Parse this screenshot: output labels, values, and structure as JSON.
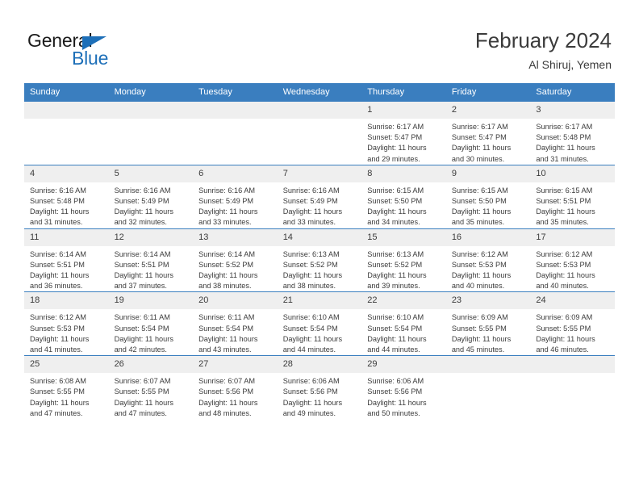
{
  "brand": {
    "name_primary": "General",
    "name_secondary": "Blue",
    "accent_color": "#1d6fb8"
  },
  "header": {
    "title": "February 2024",
    "subtitle": "Al Shiruj, Yemen"
  },
  "theme": {
    "header_row_bg": "#3a7ebf",
    "daynum_bg": "#efefef",
    "text_color": "#3b3b3b"
  },
  "calendar": {
    "weekday_headers": [
      "Sunday",
      "Monday",
      "Tuesday",
      "Wednesday",
      "Thursday",
      "Friday",
      "Saturday"
    ],
    "weeks": [
      [
        {
          "day": "",
          "sunrise": "",
          "sunset": "",
          "daylight_line1": "",
          "daylight_line2": ""
        },
        {
          "day": "",
          "sunrise": "",
          "sunset": "",
          "daylight_line1": "",
          "daylight_line2": ""
        },
        {
          "day": "",
          "sunrise": "",
          "sunset": "",
          "daylight_line1": "",
          "daylight_line2": ""
        },
        {
          "day": "",
          "sunrise": "",
          "sunset": "",
          "daylight_line1": "",
          "daylight_line2": ""
        },
        {
          "day": "1",
          "sunrise": "Sunrise: 6:17 AM",
          "sunset": "Sunset: 5:47 PM",
          "daylight_line1": "Daylight: 11 hours",
          "daylight_line2": "and 29 minutes."
        },
        {
          "day": "2",
          "sunrise": "Sunrise: 6:17 AM",
          "sunset": "Sunset: 5:47 PM",
          "daylight_line1": "Daylight: 11 hours",
          "daylight_line2": "and 30 minutes."
        },
        {
          "day": "3",
          "sunrise": "Sunrise: 6:17 AM",
          "sunset": "Sunset: 5:48 PM",
          "daylight_line1": "Daylight: 11 hours",
          "daylight_line2": "and 31 minutes."
        }
      ],
      [
        {
          "day": "4",
          "sunrise": "Sunrise: 6:16 AM",
          "sunset": "Sunset: 5:48 PM",
          "daylight_line1": "Daylight: 11 hours",
          "daylight_line2": "and 31 minutes."
        },
        {
          "day": "5",
          "sunrise": "Sunrise: 6:16 AM",
          "sunset": "Sunset: 5:49 PM",
          "daylight_line1": "Daylight: 11 hours",
          "daylight_line2": "and 32 minutes."
        },
        {
          "day": "6",
          "sunrise": "Sunrise: 6:16 AM",
          "sunset": "Sunset: 5:49 PM",
          "daylight_line1": "Daylight: 11 hours",
          "daylight_line2": "and 33 minutes."
        },
        {
          "day": "7",
          "sunrise": "Sunrise: 6:16 AM",
          "sunset": "Sunset: 5:49 PM",
          "daylight_line1": "Daylight: 11 hours",
          "daylight_line2": "and 33 minutes."
        },
        {
          "day": "8",
          "sunrise": "Sunrise: 6:15 AM",
          "sunset": "Sunset: 5:50 PM",
          "daylight_line1": "Daylight: 11 hours",
          "daylight_line2": "and 34 minutes."
        },
        {
          "day": "9",
          "sunrise": "Sunrise: 6:15 AM",
          "sunset": "Sunset: 5:50 PM",
          "daylight_line1": "Daylight: 11 hours",
          "daylight_line2": "and 35 minutes."
        },
        {
          "day": "10",
          "sunrise": "Sunrise: 6:15 AM",
          "sunset": "Sunset: 5:51 PM",
          "daylight_line1": "Daylight: 11 hours",
          "daylight_line2": "and 35 minutes."
        }
      ],
      [
        {
          "day": "11",
          "sunrise": "Sunrise: 6:14 AM",
          "sunset": "Sunset: 5:51 PM",
          "daylight_line1": "Daylight: 11 hours",
          "daylight_line2": "and 36 minutes."
        },
        {
          "day": "12",
          "sunrise": "Sunrise: 6:14 AM",
          "sunset": "Sunset: 5:51 PM",
          "daylight_line1": "Daylight: 11 hours",
          "daylight_line2": "and 37 minutes."
        },
        {
          "day": "13",
          "sunrise": "Sunrise: 6:14 AM",
          "sunset": "Sunset: 5:52 PM",
          "daylight_line1": "Daylight: 11 hours",
          "daylight_line2": "and 38 minutes."
        },
        {
          "day": "14",
          "sunrise": "Sunrise: 6:13 AM",
          "sunset": "Sunset: 5:52 PM",
          "daylight_line1": "Daylight: 11 hours",
          "daylight_line2": "and 38 minutes."
        },
        {
          "day": "15",
          "sunrise": "Sunrise: 6:13 AM",
          "sunset": "Sunset: 5:52 PM",
          "daylight_line1": "Daylight: 11 hours",
          "daylight_line2": "and 39 minutes."
        },
        {
          "day": "16",
          "sunrise": "Sunrise: 6:12 AM",
          "sunset": "Sunset: 5:53 PM",
          "daylight_line1": "Daylight: 11 hours",
          "daylight_line2": "and 40 minutes."
        },
        {
          "day": "17",
          "sunrise": "Sunrise: 6:12 AM",
          "sunset": "Sunset: 5:53 PM",
          "daylight_line1": "Daylight: 11 hours",
          "daylight_line2": "and 40 minutes."
        }
      ],
      [
        {
          "day": "18",
          "sunrise": "Sunrise: 6:12 AM",
          "sunset": "Sunset: 5:53 PM",
          "daylight_line1": "Daylight: 11 hours",
          "daylight_line2": "and 41 minutes."
        },
        {
          "day": "19",
          "sunrise": "Sunrise: 6:11 AM",
          "sunset": "Sunset: 5:54 PM",
          "daylight_line1": "Daylight: 11 hours",
          "daylight_line2": "and 42 minutes."
        },
        {
          "day": "20",
          "sunrise": "Sunrise: 6:11 AM",
          "sunset": "Sunset: 5:54 PM",
          "daylight_line1": "Daylight: 11 hours",
          "daylight_line2": "and 43 minutes."
        },
        {
          "day": "21",
          "sunrise": "Sunrise: 6:10 AM",
          "sunset": "Sunset: 5:54 PM",
          "daylight_line1": "Daylight: 11 hours",
          "daylight_line2": "and 44 minutes."
        },
        {
          "day": "22",
          "sunrise": "Sunrise: 6:10 AM",
          "sunset": "Sunset: 5:54 PM",
          "daylight_line1": "Daylight: 11 hours",
          "daylight_line2": "and 44 minutes."
        },
        {
          "day": "23",
          "sunrise": "Sunrise: 6:09 AM",
          "sunset": "Sunset: 5:55 PM",
          "daylight_line1": "Daylight: 11 hours",
          "daylight_line2": "and 45 minutes."
        },
        {
          "day": "24",
          "sunrise": "Sunrise: 6:09 AM",
          "sunset": "Sunset: 5:55 PM",
          "daylight_line1": "Daylight: 11 hours",
          "daylight_line2": "and 46 minutes."
        }
      ],
      [
        {
          "day": "25",
          "sunrise": "Sunrise: 6:08 AM",
          "sunset": "Sunset: 5:55 PM",
          "daylight_line1": "Daylight: 11 hours",
          "daylight_line2": "and 47 minutes."
        },
        {
          "day": "26",
          "sunrise": "Sunrise: 6:07 AM",
          "sunset": "Sunset: 5:55 PM",
          "daylight_line1": "Daylight: 11 hours",
          "daylight_line2": "and 47 minutes."
        },
        {
          "day": "27",
          "sunrise": "Sunrise: 6:07 AM",
          "sunset": "Sunset: 5:56 PM",
          "daylight_line1": "Daylight: 11 hours",
          "daylight_line2": "and 48 minutes."
        },
        {
          "day": "28",
          "sunrise": "Sunrise: 6:06 AM",
          "sunset": "Sunset: 5:56 PM",
          "daylight_line1": "Daylight: 11 hours",
          "daylight_line2": "and 49 minutes."
        },
        {
          "day": "29",
          "sunrise": "Sunrise: 6:06 AM",
          "sunset": "Sunset: 5:56 PM",
          "daylight_line1": "Daylight: 11 hours",
          "daylight_line2": "and 50 minutes."
        },
        {
          "day": "",
          "sunrise": "",
          "sunset": "",
          "daylight_line1": "",
          "daylight_line2": ""
        },
        {
          "day": "",
          "sunrise": "",
          "sunset": "",
          "daylight_line1": "",
          "daylight_line2": ""
        }
      ]
    ]
  }
}
